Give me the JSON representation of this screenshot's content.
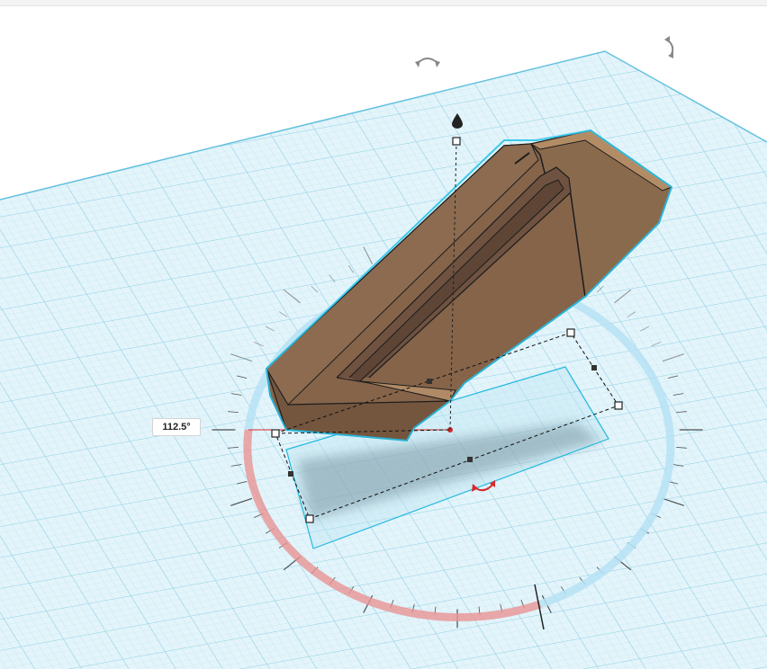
{
  "rotation_readout": {
    "angle": "112.5°"
  },
  "icons": {
    "view_rotate_left": "rotate-view-icon",
    "view_rotate_right": "rotate-view-icon",
    "lift_handle": "lift-cone-icon",
    "rotate_handle": "curved-rotate-arrow-icon"
  },
  "colors": {
    "grid_fill": "#dff2f8",
    "grid_line": "#9fd8ea",
    "grid_border": "#6cc4e0",
    "object_body": "#86654a",
    "object_dark": "#6b4f38",
    "object_light": "#a7825f",
    "selection_outline": "#27c3ea",
    "arc_rotated": "#e88a8a",
    "arc_remaining": "#a9dcf2",
    "handle_red": "#d62a2a"
  }
}
